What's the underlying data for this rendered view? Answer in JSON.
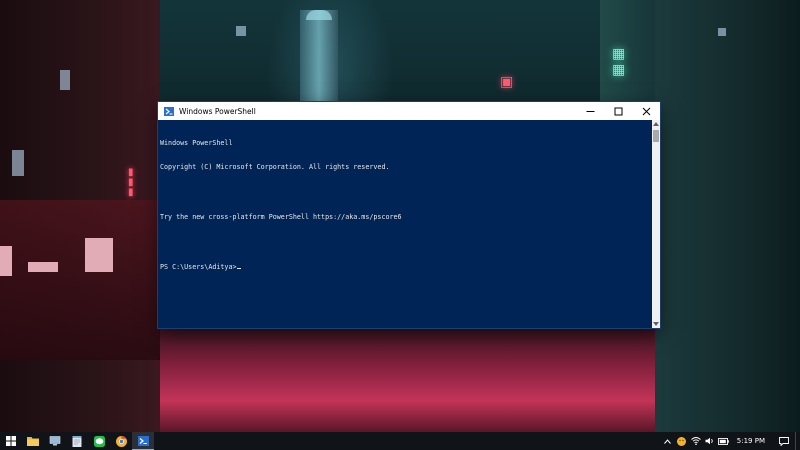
{
  "window": {
    "title": "Windows PowerShell",
    "controls": {
      "minimize": "minimize",
      "maximize": "maximize",
      "close": "close"
    }
  },
  "console": {
    "lines": [
      "Windows PowerShell",
      "Copyright (C) Microsoft Corporation. All rights reserved.",
      "",
      "Try the new cross-platform PowerShell https://aka.ms/pscore6",
      "",
      "PS C:\\Users\\Aditya>"
    ]
  },
  "taskbar": {
    "items": [
      {
        "icon": "windows-start-icon"
      },
      {
        "icon": "file-explorer-icon"
      },
      {
        "icon": "computer-icon"
      },
      {
        "icon": "notepad-icon"
      },
      {
        "icon": "line-messenger-icon"
      },
      {
        "icon": "chrome-icon"
      },
      {
        "icon": "powershell-icon",
        "active": true
      }
    ],
    "tray": [
      "chevron-up-icon",
      "emoji-app-icon",
      "network-icon",
      "volume-icon",
      "battery-icon"
    ],
    "clock": "5:19 PM"
  },
  "colors": {
    "console_bg": "#012456",
    "console_text": "#e8e8e8",
    "taskbar_bg": "#101317",
    "accent": "#7fb0e8"
  }
}
